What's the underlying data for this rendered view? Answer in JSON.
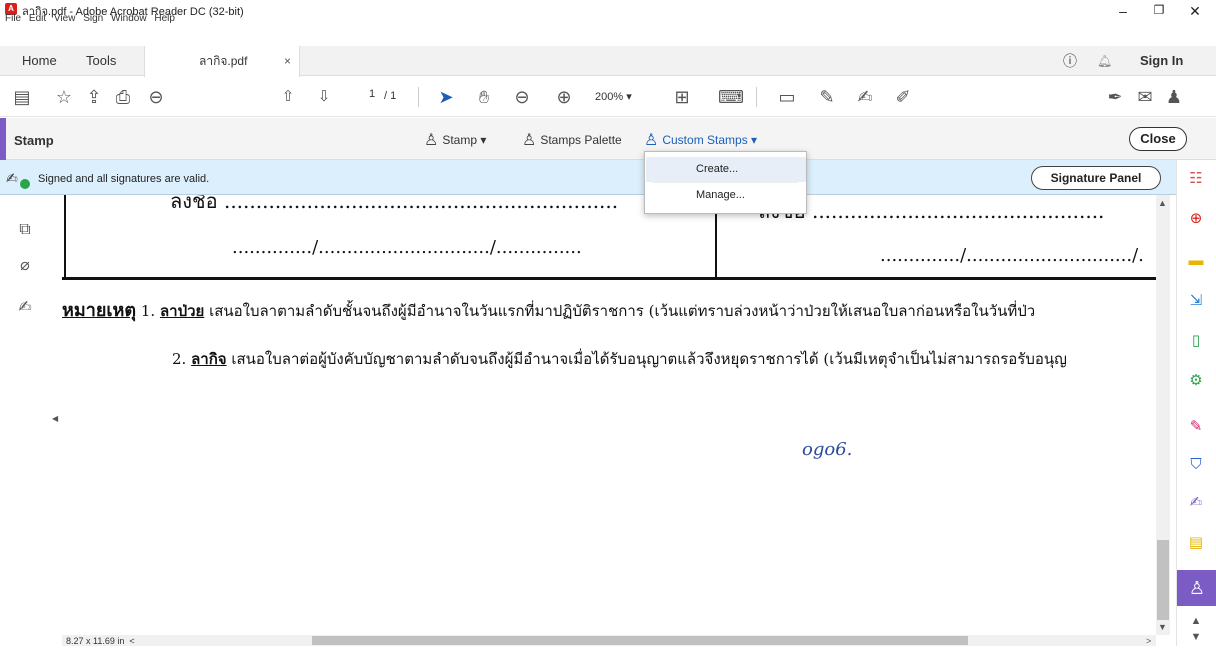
{
  "window": {
    "title": "ลากิจ.pdf - Adobe Acrobat Reader DC (32-bit)",
    "minimize": "–",
    "maximize": "❐",
    "close": "✕"
  },
  "menu": [
    "File",
    "Edit",
    "View",
    "Sign",
    "Window",
    "Help"
  ],
  "tabs": {
    "home": "Home",
    "tools": "Tools",
    "doc": "ลากิจ.pdf",
    "doc_close": "×",
    "sign_in": "Sign In"
  },
  "toolbar": {
    "page_current": "1",
    "page_total": "/ 1",
    "zoom": "200%"
  },
  "stampbar": {
    "title": "Stamp",
    "stamp_btn": "Stamp ▾",
    "palette_btn": "Stamps Palette",
    "custom_btn": "Custom Stamps ▾",
    "close_btn": "Close"
  },
  "dropdown": {
    "create": "Create...",
    "manage": "Manage..."
  },
  "signature": {
    "status": "Signed and all signatures are valid.",
    "panel_btn": "Signature Panel"
  },
  "document": {
    "sign_left": "ลงชื่อ ..............................................................",
    "date_left": "............../............................../...............",
    "sign_right": "ลงชื่อ ..............................................",
    "date_right": "............../............................./.",
    "note_label": "หมายเหตุ",
    "note1_num": "1.",
    "note1_bold": "ลาป่วย",
    "note1_text": " เสนอใบลาตามลำดับชั้นจนถึงผู้มีอำนาจในวันแรกที่มาปฏิบัติราชการ (เว้นแต่ทราบล่วงหน้าว่าป่วยให้เสนอใบลาก่อนหรือในวันที่ป่ว",
    "note2_num": "2.",
    "note2_bold": "ลากิจ",
    "note2_text": " เสนอใบลาต่อผู้บังคับบัญชาตามลำดับจนถึงผู้มีอำนาจเมื่อได้รับอนุญาตแล้วจึงหยุดราชการได้ (เว้นมีเหตุจำเป็นไม่สามารถรอรับอนุญ",
    "handwriting": "ogo6.",
    "page_size": "8.27 x 11.69 in"
  }
}
